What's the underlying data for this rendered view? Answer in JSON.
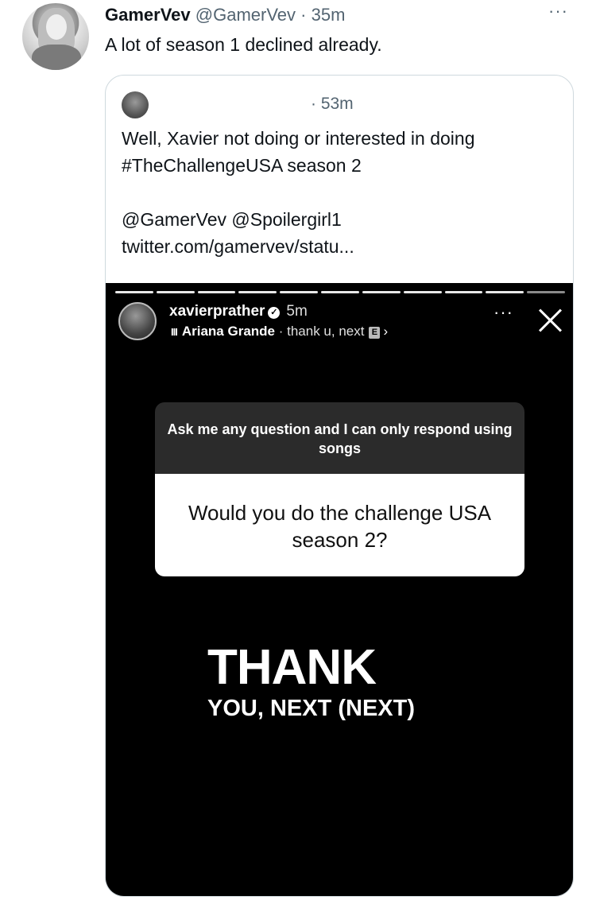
{
  "tweet": {
    "name": "GamerVev",
    "handle": "@GamerVev",
    "time": "· 35m",
    "text": "A lot of season 1 declined already.",
    "more_icon": "more-horizontal-icon"
  },
  "quote": {
    "time": "· 53m",
    "lines": [
      "Well, Xavier not doing or interested in doing",
      "#TheChallengeUSA season 2",
      "@GamerVev @Spoilergirl1",
      "twitter.com/gamervev/statu..."
    ]
  },
  "story": {
    "username": "xavierprather",
    "verified_icon": "✓",
    "time": "5m",
    "music_bars": "III",
    "artist": "Ariana Grande",
    "song": "· thank u, next",
    "explicit": "E",
    "chevron": "›",
    "more": "···",
    "question_prompt": "Ask me any question and I can only respond using songs",
    "question": "Would you do the challenge USA season 2?",
    "lyric_big": "THANK",
    "lyric_small": "YOU, NEXT (NEXT)"
  }
}
